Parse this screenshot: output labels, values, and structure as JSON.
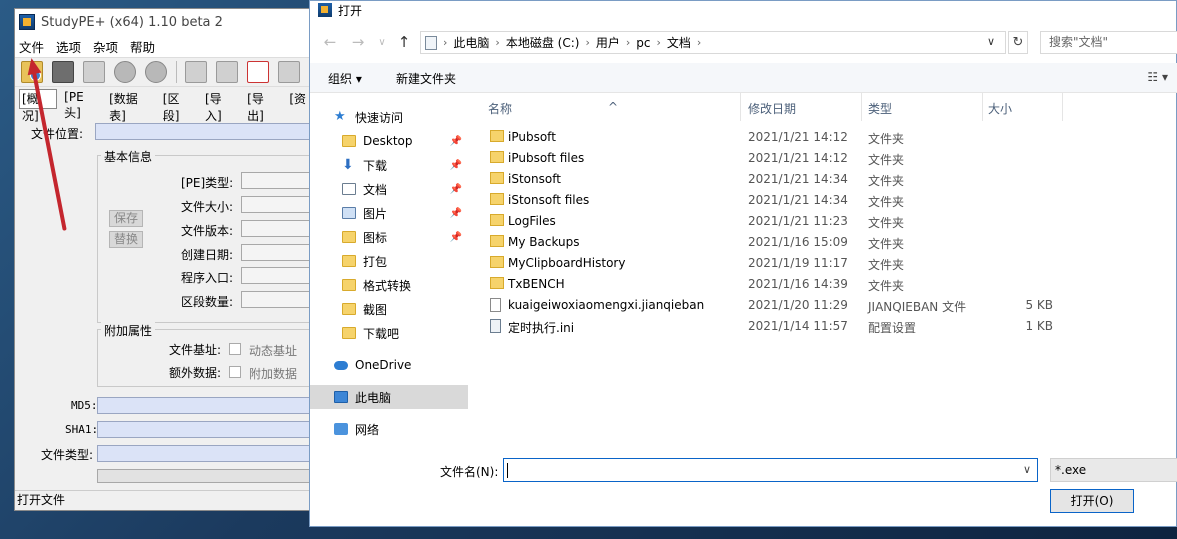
{
  "studype": {
    "title": "StudyPE+ (x64) 1.10 beta 2",
    "menu": [
      "文件",
      "选项",
      "杂项",
      "帮助"
    ],
    "tabs": [
      "[概况]",
      "[PE头]",
      "[数据表]",
      "[区段]",
      "[导入]",
      "[导出]",
      "[资"
    ],
    "fields": {
      "file_location": "文件位置:",
      "basic_info": "基本信息",
      "pe_type": "[PE]类型:",
      "file_size": "文件大小:",
      "file_version": "文件版本:",
      "created": "创建日期:",
      "entry": "程序入口:",
      "section_count": "区段数量:",
      "save": "保存",
      "replace": "替换",
      "extra_attr": "附加属性",
      "file_base": "文件基址:",
      "dynamic_base": "动态基址",
      "extra_data": "额外数据:",
      "extra_data_chk": "附加数据",
      "md5": "MD5:",
      "sha1": "SHA1:",
      "file_type": "文件类型:"
    },
    "status": "打开文件"
  },
  "dialog": {
    "title": "打开",
    "breadcrumb": [
      "此电脑",
      "本地磁盘 (C:)",
      "用户",
      "pc",
      "文档"
    ],
    "search_placeholder": "搜索\"文档\"",
    "organize": "组织 ▾",
    "new_folder": "新建文件夹",
    "nav": [
      {
        "label": "快速访问",
        "icon": "star-icon"
      },
      {
        "label": "Desktop",
        "icon": "folder-icon",
        "pinned": true
      },
      {
        "label": "下载",
        "icon": "download-icon",
        "pinned": true
      },
      {
        "label": "文档",
        "icon": "document-icon",
        "pinned": true
      },
      {
        "label": "图片",
        "icon": "picture-icon",
        "pinned": true
      },
      {
        "label": "图标",
        "icon": "folder-icon",
        "pinned": true
      },
      {
        "label": "打包",
        "icon": "folder-icon"
      },
      {
        "label": "格式转换",
        "icon": "folder-icon"
      },
      {
        "label": "截图",
        "icon": "folder-icon"
      },
      {
        "label": "下载吧",
        "icon": "folder-icon"
      },
      {
        "label": "OneDrive",
        "icon": "cloud-icon"
      },
      {
        "label": "此电脑",
        "icon": "computer-icon",
        "selected": true
      },
      {
        "label": "网络",
        "icon": "network-icon"
      }
    ],
    "columns": {
      "name": "名称",
      "date": "修改日期",
      "type": "类型",
      "size": "大小"
    },
    "files": [
      {
        "name": "iPubsoft",
        "date": "2021/1/21 14:12",
        "type": "文件夹",
        "size": "",
        "kind": "folder"
      },
      {
        "name": "iPubsoft files",
        "date": "2021/1/21 14:12",
        "type": "文件夹",
        "size": "",
        "kind": "folder"
      },
      {
        "name": "iStonsoft",
        "date": "2021/1/21 14:34",
        "type": "文件夹",
        "size": "",
        "kind": "folder"
      },
      {
        "name": "iStonsoft files",
        "date": "2021/1/21 14:34",
        "type": "文件夹",
        "size": "",
        "kind": "folder"
      },
      {
        "name": "LogFiles",
        "date": "2021/1/21 11:23",
        "type": "文件夹",
        "size": "",
        "kind": "folder"
      },
      {
        "name": "My Backups",
        "date": "2021/1/16 15:09",
        "type": "文件夹",
        "size": "",
        "kind": "folder"
      },
      {
        "name": "MyClipboardHistory",
        "date": "2021/1/19 11:17",
        "type": "文件夹",
        "size": "",
        "kind": "folder"
      },
      {
        "name": "TxBENCH",
        "date": "2021/1/16 14:39",
        "type": "文件夹",
        "size": "",
        "kind": "folder"
      },
      {
        "name": "kuaigeiwoxiaomengxi.jianqieban",
        "date": "2021/1/20 11:29",
        "type": "JIANQIEBAN 文件",
        "size": "5 KB",
        "kind": "file"
      },
      {
        "name": "定时执行.ini",
        "date": "2021/1/14 11:57",
        "type": "配置设置",
        "size": "1 KB",
        "kind": "cfg"
      }
    ],
    "filename_label": "文件名(N):",
    "filename_value": "",
    "filter": "*.exe",
    "open_button": "打开(O)"
  }
}
